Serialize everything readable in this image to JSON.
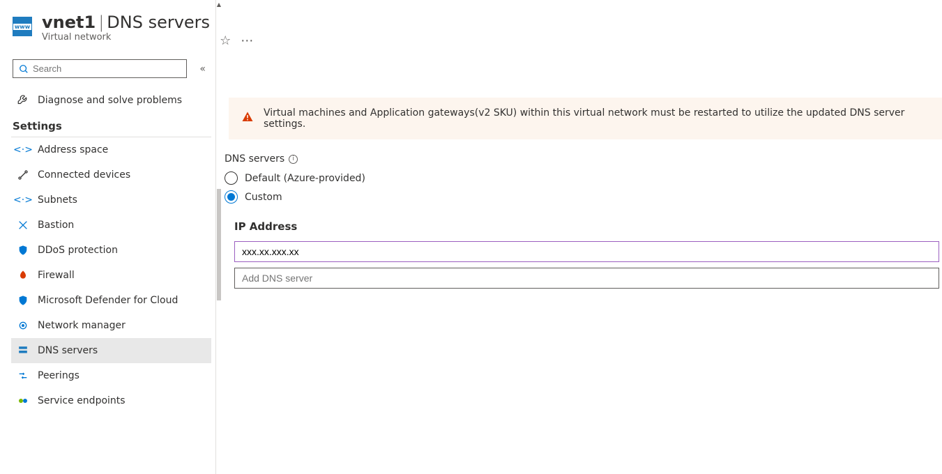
{
  "header": {
    "resource_name": "vnet1",
    "page_suffix": "DNS servers",
    "subtitle": "Virtual network",
    "search_placeholder": "Search"
  },
  "sidebar": {
    "diagnose_label": "Diagnose and solve problems",
    "settings_section": "Settings",
    "items": [
      {
        "label": "Address space"
      },
      {
        "label": "Connected devices"
      },
      {
        "label": "Subnets"
      },
      {
        "label": "Bastion"
      },
      {
        "label": "DDoS protection"
      },
      {
        "label": "Firewall"
      },
      {
        "label": "Microsoft Defender for Cloud"
      },
      {
        "label": "Network manager"
      },
      {
        "label": "DNS servers"
      },
      {
        "label": "Peerings"
      },
      {
        "label": "Service endpoints"
      }
    ]
  },
  "banner": {
    "text": "Virtual machines and Application gateways(v2 SKU) within this virtual network must be restarted to utilize the updated DNS server settings."
  },
  "form": {
    "dns_label": "DNS servers",
    "option_default": "Default (Azure-provided)",
    "option_custom": "Custom",
    "ip_heading": "IP Address",
    "ip_value_1": "xxx.xx.xxx.xx",
    "add_placeholder": "Add DNS server"
  }
}
